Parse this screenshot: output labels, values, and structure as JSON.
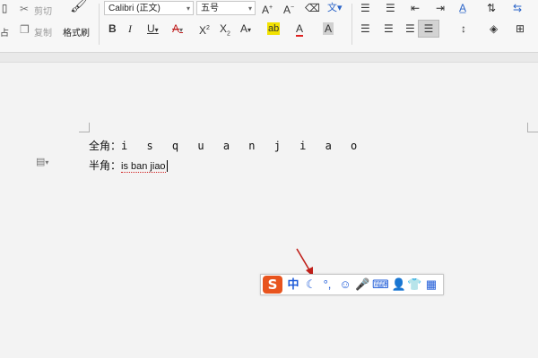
{
  "ribbon": {
    "clipboard": {
      "cut_label": "剪切",
      "copy_label": "复制",
      "paste_fragment": "占",
      "format_painter_label": "格式刷"
    },
    "font": {
      "family": "Calibri (正文)",
      "size": "五号"
    },
    "icons": [
      "cut-icon",
      "copy-icon",
      "format-painter-icon",
      "grow-font-icon",
      "shrink-font-icon",
      "clear-format-icon",
      "phonetic-guide-icon",
      "bold-icon",
      "italic-icon",
      "underline-icon",
      "strikethrough-icon",
      "superscript-icon",
      "subscript-icon",
      "text-effect-icon",
      "highlight-icon",
      "font-color-icon",
      "char-shading-icon",
      "bullets-icon",
      "numbering-icon",
      "decrease-indent-icon",
      "increase-indent-icon",
      "chinese-layout-icon",
      "sort-icon",
      "show-marks-icon",
      "align-left-icon",
      "align-center-icon",
      "align-right-icon",
      "justify-icon",
      "line-spacing-icon",
      "shading-icon",
      "borders-icon"
    ]
  },
  "document": {
    "line1": {
      "label": "全角：",
      "text": "i s  q u a n  j i a o"
    },
    "line2": {
      "label": "半角：",
      "text": "is ban jiao"
    }
  },
  "ime": {
    "logo": "S",
    "mode": "中",
    "icons": [
      "half-width-moon-icon",
      "punctuation-icon",
      "emoji-icon",
      "voice-mic-icon",
      "keyboard-icon",
      "user-icon",
      "skin-shirt-icon",
      "toolbox-grid-icon"
    ]
  },
  "annotation": {
    "arrow_color": "#c0201a"
  },
  "colors": {
    "ime_blue": "#1e5bd8",
    "logo_orange": "#e8541e",
    "highlight_yellow": "#f2e200",
    "font_red": "#e02020"
  }
}
